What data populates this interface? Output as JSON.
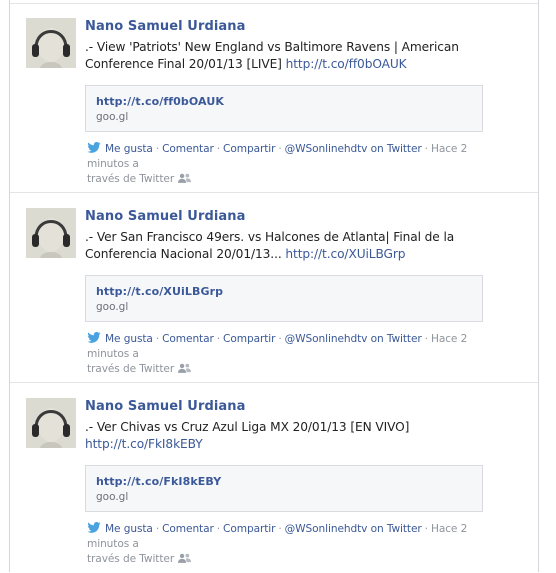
{
  "posts": [
    {
      "author": "Nano Samuel Urdiana",
      "text": ".- View 'Patriots' New England vs Baltimore Ravens | American Conference Final 20/01/13 [LIVE] ",
      "link": "http://t.co/ff0bOAUK",
      "card": {
        "url": "http://t.co/ff0bOAUK",
        "domain": "goo.gl"
      },
      "actions": {
        "like": "Me gusta",
        "comment": "Comentar",
        "share": "Compartir",
        "source": "@WSonlinehdtv on Twitter",
        "time": "Hace 2 minutos a",
        "via": "través de Twitter"
      }
    },
    {
      "author": "Nano Samuel Urdiana",
      "text": ".- Ver San Francisco 49ers. vs Halcones de Atlanta| Final de la Conferencia Nacional 20/01/13... ",
      "link": "http://t.co/XUiLBGrp",
      "card": {
        "url": "http://t.co/XUiLBGrp",
        "domain": "goo.gl"
      },
      "actions": {
        "like": "Me gusta",
        "comment": "Comentar",
        "share": "Compartir",
        "source": "@WSonlinehdtv on Twitter",
        "time": "Hace 2 minutos a",
        "via": "través de Twitter"
      }
    },
    {
      "author": "Nano Samuel Urdiana",
      "text": ".- Ver Chivas vs Cruz Azul Liga MX 20/01/13 [EN VIVO] ",
      "link": "http://t.co/FkI8kEBY",
      "card": {
        "url": "http://t.co/FkI8kEBY",
        "domain": "goo.gl"
      },
      "actions": {
        "like": "Me gusta",
        "comment": "Comentar",
        "share": "Compartir",
        "source": "@WSonlinehdtv on Twitter",
        "time": "Hace 2 minutos a",
        "via": "través de Twitter"
      }
    }
  ],
  "icons": {
    "source": "twitter-bird-icon",
    "audience": "friends-audience-icon"
  },
  "colors": {
    "link": "#3b5998",
    "twitter": "#4aa3df",
    "meta": "#8f949c"
  }
}
